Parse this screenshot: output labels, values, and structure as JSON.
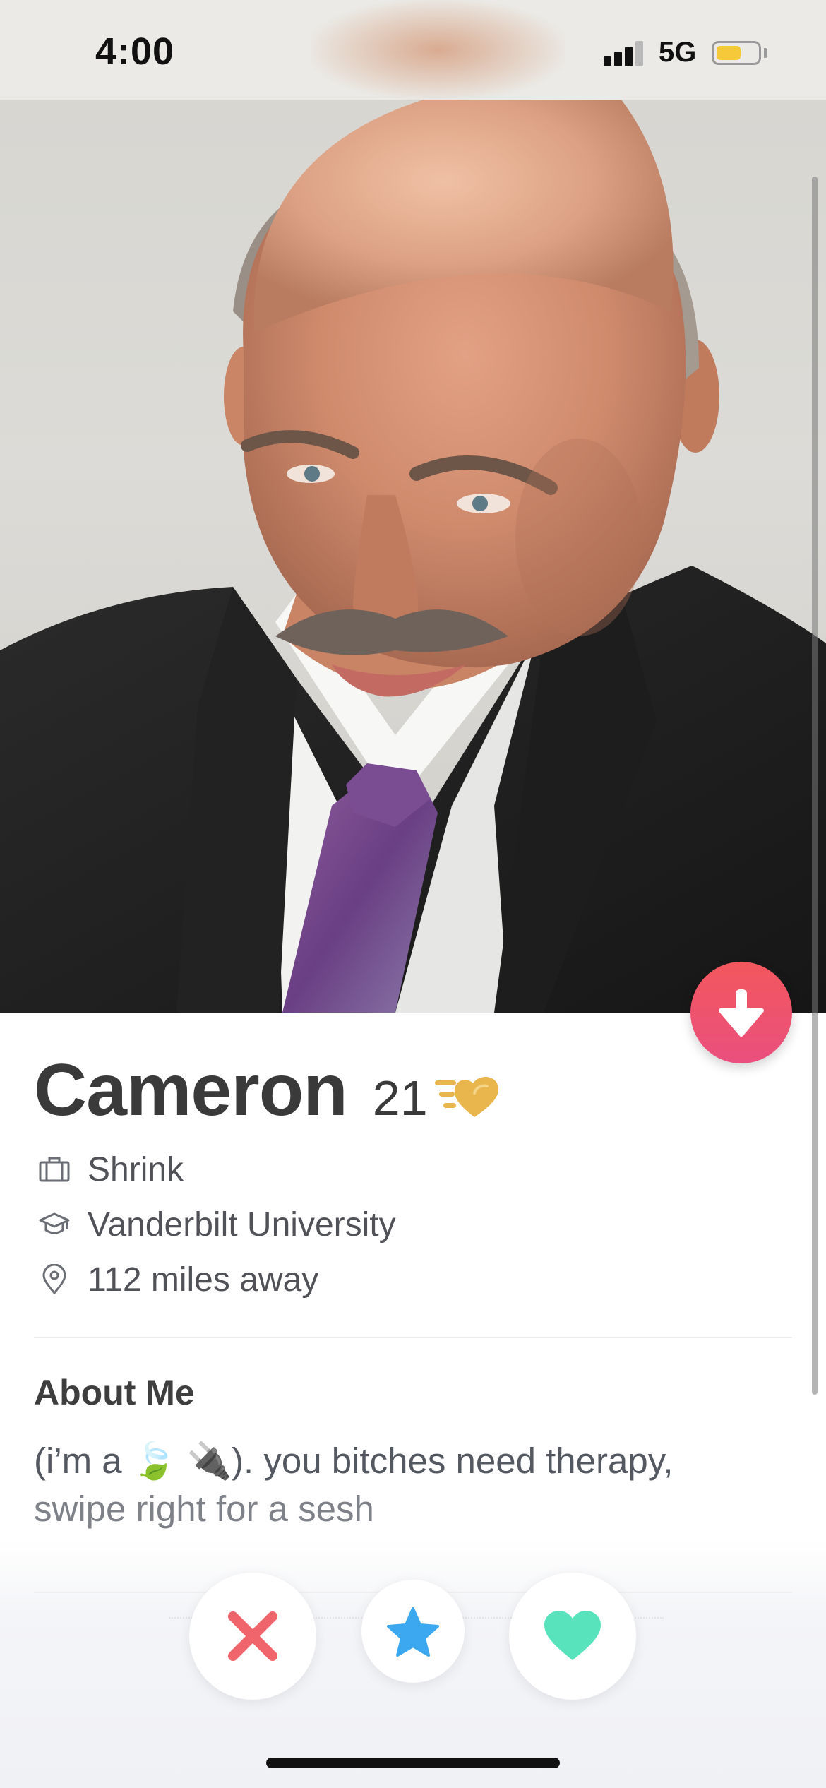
{
  "status_bar": {
    "time": "4:00",
    "network": "5G",
    "signal_bars_active": 3,
    "signal_bars_total": 4,
    "battery_level": 0.6,
    "battery_color": "#f6c93a"
  },
  "profile": {
    "name": "Cameron",
    "age": "21",
    "job": "Shrink",
    "school": "Vanderbilt University",
    "distance": "112 miles away",
    "about_heading": "About Me",
    "bio_line1": "(i’m a 🍃 🔌). you bitches need therapy,",
    "bio_line2": "swipe right for a sesh"
  },
  "icons": {
    "collapse": "arrow-down-icon",
    "job": "briefcase-icon",
    "school": "graduation-cap-icon",
    "distance": "location-pin-icon",
    "badge": "super-like-heart-icon",
    "nope": "x-icon",
    "super_like": "star-icon",
    "like": "heart-icon"
  },
  "colors": {
    "accent": "#ef5368",
    "nope": "#f0646c",
    "super_like": "#3ba8ef",
    "like": "#59e3bd",
    "badge_gold": "#e9b64d"
  }
}
